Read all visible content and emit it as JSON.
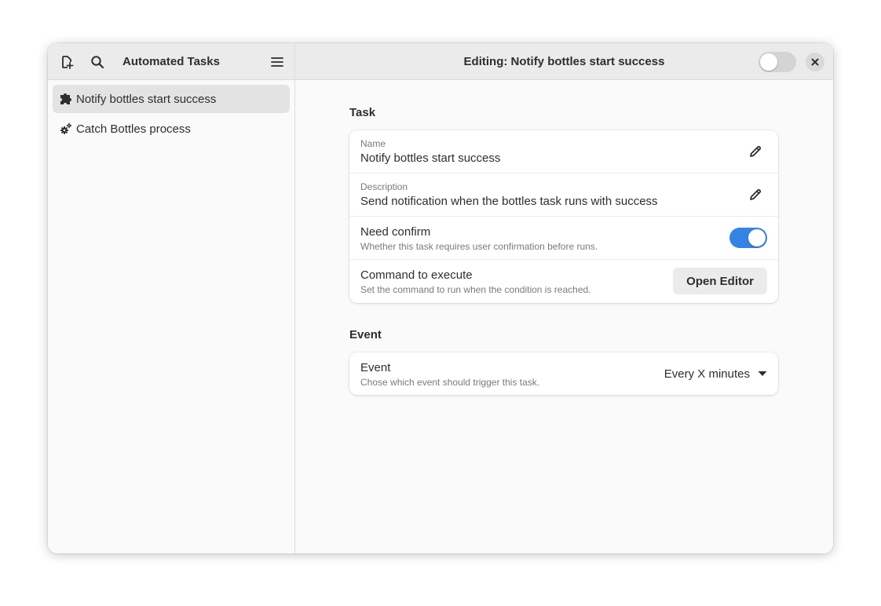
{
  "sidebar": {
    "title": "Automated Tasks",
    "new_task_icon": "document-new-icon",
    "search_icon": "search-icon",
    "menu_icon": "hamburger-menu-icon",
    "tasks": [
      {
        "label": "Notify bottles start success",
        "icon": "puzzle-icon",
        "selected": true
      },
      {
        "label": "Catch Bottles process",
        "icon": "gears-icon",
        "selected": false
      }
    ]
  },
  "header": {
    "title": "Editing: Notify bottles start success",
    "toggle_enabled": false,
    "close_icon": "close-icon"
  },
  "task_section": {
    "title": "Task",
    "name_label": "Name",
    "name_value": "Notify bottles start success",
    "description_label": "Description",
    "description_value": "Send notification when the bottles task runs with success",
    "need_confirm_title": "Need confirm",
    "need_confirm_subtitle": "Whether this task requires user confirmation before runs.",
    "need_confirm_enabled": true,
    "command_title": "Command to execute",
    "command_subtitle": "Set the command to run when the condition is reached.",
    "open_editor_label": "Open Editor"
  },
  "event_section": {
    "title": "Event",
    "event_title": "Event",
    "event_subtitle": "Chose which event should trigger this task.",
    "event_selected": "Every X minutes"
  },
  "colors": {
    "accent": "#3584e4",
    "header_bg": "#ebebeb",
    "selected_bg": "#e3e3e3"
  }
}
